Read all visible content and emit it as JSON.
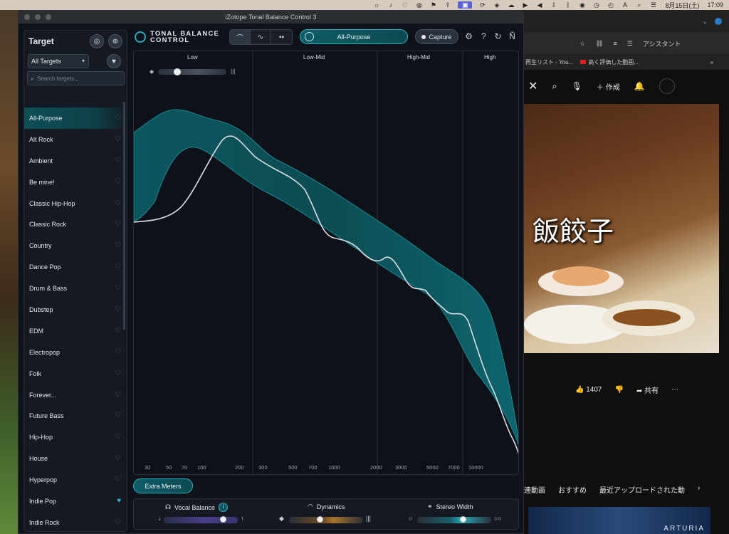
{
  "menubar": {
    "date": "8月15日(土)",
    "time": "17:09",
    "input_mode": "A"
  },
  "youtube": {
    "bookmarks": [
      "再生リスト - You...",
      "高く評価した動画..."
    ],
    "header": {
      "create_label": "作成"
    },
    "video": {
      "caption": "飯餃子"
    },
    "actions": {
      "likes": "1407",
      "share_label": "共有"
    },
    "tabs": [
      "連動画",
      "おすすめ",
      "最近アップロードされた動"
    ],
    "thumb_text": "ARTURIA",
    "addr_label": "アシスタント"
  },
  "app": {
    "title": "iZotope Tonal Balance Control 3",
    "logo_line1": "TONAL BALANCE",
    "logo_line2": "CONTROL",
    "preset": "All-Purpose",
    "capture_label": "Capture",
    "extra_meters_label": "Extra Meters",
    "accent_color": "#2bb0c0",
    "curve_fill_color": "#0f5a62"
  },
  "sidebar": {
    "title": "Target",
    "dropdown_value": "All Targets",
    "search_placeholder": "Search targets...",
    "items": [
      {
        "label": "All-Purpose",
        "selected": true,
        "favorite": false
      },
      {
        "label": "Alt Rock",
        "selected": false,
        "favorite": false
      },
      {
        "label": "Ambient",
        "selected": false,
        "favorite": false
      },
      {
        "label": "Be mine!",
        "selected": false,
        "favorite": false
      },
      {
        "label": "Classic Hip-Hop",
        "selected": false,
        "favorite": false
      },
      {
        "label": "Classic Rock",
        "selected": false,
        "favorite": false
      },
      {
        "label": "Country",
        "selected": false,
        "favorite": false
      },
      {
        "label": "Dance Pop",
        "selected": false,
        "favorite": false
      },
      {
        "label": "Drum & Bass",
        "selected": false,
        "favorite": false
      },
      {
        "label": "Dubstep",
        "selected": false,
        "favorite": false
      },
      {
        "label": "EDM",
        "selected": false,
        "favorite": false
      },
      {
        "label": "Electropop",
        "selected": false,
        "favorite": false
      },
      {
        "label": "Folk",
        "selected": false,
        "favorite": false
      },
      {
        "label": "Forever...",
        "selected": false,
        "favorite": false
      },
      {
        "label": "Future Bass",
        "selected": false,
        "favorite": false
      },
      {
        "label": "Hip-Hop",
        "selected": false,
        "favorite": false
      },
      {
        "label": "House",
        "selected": false,
        "favorite": false
      },
      {
        "label": "Hyperpop",
        "selected": false,
        "favorite": false
      },
      {
        "label": "Indie Pop",
        "selected": false,
        "favorite": true
      },
      {
        "label": "Indie Rock",
        "selected": false,
        "favorite": false
      }
    ]
  },
  "graph": {
    "bands": [
      "Low",
      "Low-Mid",
      "High-Mid",
      "High"
    ],
    "freq_ticks": [
      "30",
      "50",
      "70",
      "100",
      "200",
      "300",
      "500",
      "700",
      "1000",
      "2000",
      "3000",
      "5000",
      "7000",
      "10000"
    ]
  },
  "meters": {
    "vocal_balance": {
      "label": "Vocal Balance",
      "badge": "i",
      "level": 0.83
    },
    "dynamics": {
      "label": "Dynamics",
      "level": 0.41
    },
    "stereo_width": {
      "label": "Stereo Width",
      "level": 0.63
    }
  }
}
